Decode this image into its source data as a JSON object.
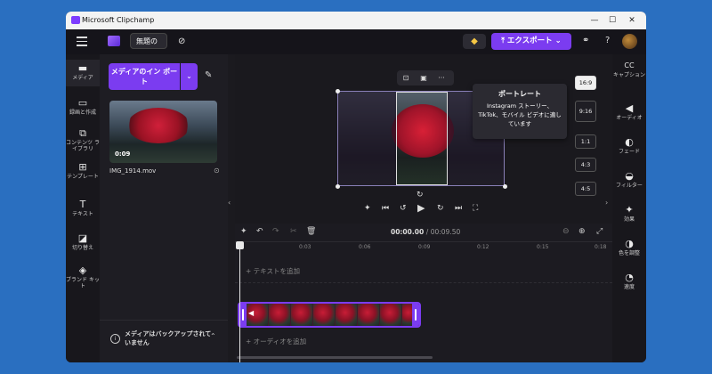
{
  "window": {
    "title": "Microsoft Clipchamp",
    "controls": {
      "minimize": "—",
      "maximize": "☐",
      "close": "✕"
    }
  },
  "toolbar": {
    "project_name": "無題の",
    "export_label": "⤒ エクスポート ⌄",
    "icons": [
      "menu-icon",
      "project-icon",
      "cloud-off-icon",
      "premium-gem-icon",
      "share-icon",
      "help-icon"
    ],
    "help_label": "?"
  },
  "left_nav": [
    {
      "label": "メディア",
      "icon": "folder-icon",
      "glyph": "▬"
    },
    {
      "label": "録画と作成",
      "icon": "camera-icon",
      "glyph": "▭"
    },
    {
      "label": "コンテンツ ライブラリ",
      "icon": "library-icon",
      "glyph": "⧉"
    },
    {
      "label": "テンプレート",
      "icon": "template-icon",
      "glyph": "⊞"
    },
    {
      "label": "テキスト",
      "icon": "text-icon",
      "glyph": "T"
    },
    {
      "label": "切り替え",
      "icon": "transition-icon",
      "glyph": "◪"
    },
    {
      "label": "ブランド キット",
      "icon": "brand-kit-icon",
      "glyph": "◈"
    }
  ],
  "media_panel": {
    "import_label": "メディアのイン ポート",
    "import_dropdown": "⌄",
    "media_item": {
      "duration": "0:09",
      "filename": "IMG_1914.mov"
    },
    "backup_note": "メディアはバックアップされていません"
  },
  "preview": {
    "tooltip": {
      "title": "ポートレート",
      "body": "Instagram ストーリー、TikTok、モバイル ビデオに適しています"
    },
    "aspect_ratios": [
      "16:9",
      "9:16",
      "1:1",
      "4:3",
      "4:5"
    ],
    "selected_ratio": "16:9",
    "hovered_ratio": "9:16"
  },
  "right_nav": [
    {
      "label": "キャプション",
      "icon": "captions-icon",
      "glyph": "CC"
    },
    {
      "label": "オーディオ",
      "icon": "speaker-icon",
      "glyph": "◀)"
    },
    {
      "label": "フェード",
      "icon": "fade-icon",
      "glyph": "◐"
    },
    {
      "label": "フィルター",
      "icon": "filter-icon",
      "glyph": "◒"
    },
    {
      "label": "効果",
      "icon": "effects-icon",
      "glyph": "✦"
    },
    {
      "label": "色を調整",
      "icon": "color-adjust-icon",
      "glyph": "◑"
    },
    {
      "label": "速度",
      "icon": "speed-icon",
      "glyph": "◔"
    }
  ],
  "timeline": {
    "current_time": "00:00.00",
    "total_time": "/ 00:09.50",
    "ticks": [
      "0",
      "0:03",
      "0:06",
      "0:09",
      "0:12",
      "0:15",
      "0:18"
    ],
    "add_text": "+ テキストを追加",
    "add_audio": "+ オーディオを追加"
  },
  "colors": {
    "accent": "#7b3cf0",
    "background": "#2a6fc0",
    "app_bg": "#1b1a1f"
  }
}
